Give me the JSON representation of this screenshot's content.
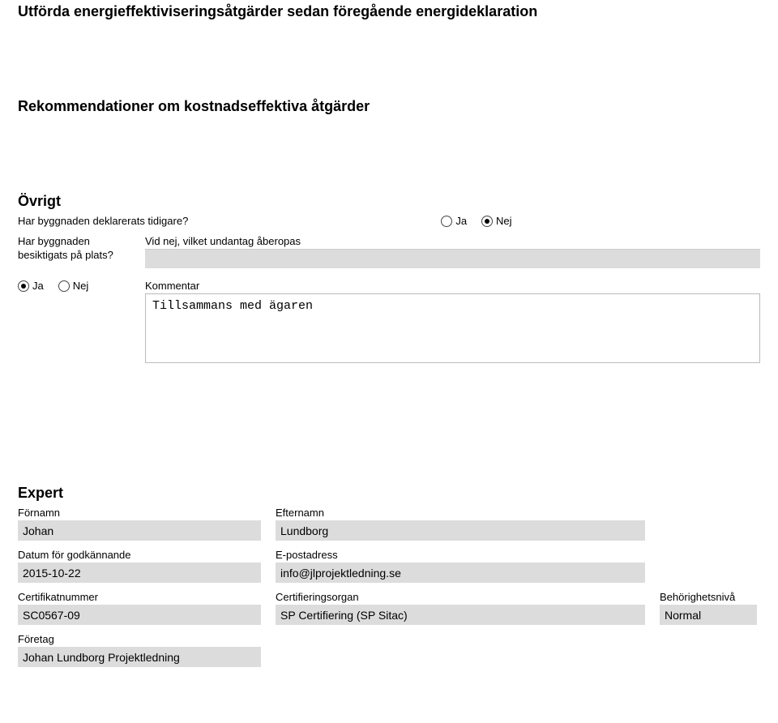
{
  "headings": {
    "h1": "Utförda energieffektiviseringsåtgärder sedan föregående energideklaration",
    "h2": "Rekommendationer om kostnadseffektiva åtgärder",
    "h3": "Övrigt",
    "h4": "Expert"
  },
  "ovrigt": {
    "deklarerats_label": "Har byggnaden deklarerats tidigare?",
    "ja": "Ja",
    "nej": "Nej",
    "besiktigats_label": "Har byggnaden besiktigats på plats?",
    "undantag_label": "Vid nej, vilket undantag åberopas",
    "undantag_value": "",
    "kommentar_label": "Kommentar",
    "kommentar_value": "Tillsammans med ägaren"
  },
  "expert": {
    "fornamn_label": "Förnamn",
    "fornamn": "Johan",
    "efternamn_label": "Efternamn",
    "efternamn": "Lundborg",
    "datum_label": "Datum för godkännande",
    "datum": "2015-10-22",
    "epost_label": "E-postadress",
    "epost": "info@jlprojektledning.se",
    "cert_label": "Certifikatnummer",
    "cert": "SC0567-09",
    "certorg_label": "Certifieringsorgan",
    "certorg": "SP Certifiering (SP Sitac)",
    "niva_label": "Behörighetsnivå",
    "niva": "Normal",
    "foretag_label": "Företag",
    "foretag": "Johan Lundborg Projektledning"
  }
}
